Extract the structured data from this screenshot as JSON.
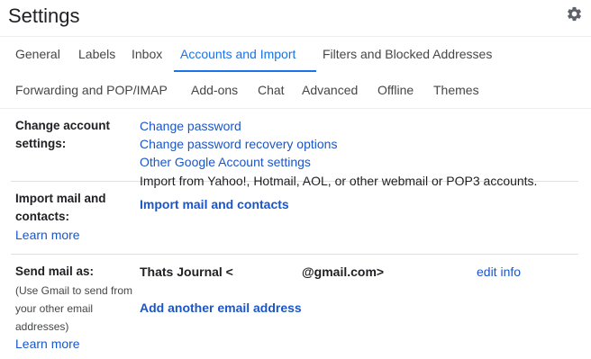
{
  "header": {
    "title": "Settings",
    "settings_icon": "gear-icon"
  },
  "tabs": {
    "row1": [
      "General",
      "Labels",
      "Inbox",
      "Accounts and Import",
      "Filters and Blocked Addresses"
    ],
    "row2": [
      "Forwarding and POP/IMAP",
      "Add-ons",
      "Chat",
      "Advanced",
      "Offline",
      "Themes"
    ],
    "active": "Accounts and Import"
  },
  "sections": {
    "change_account": {
      "label": "Change account settings:",
      "links": [
        "Change password",
        "Change password recovery options",
        "Other Google Account settings"
      ]
    },
    "import_mail": {
      "label": "Import mail and contacts:",
      "learn_more": "Learn more",
      "description": "Import from Yahoo!, Hotmail, AOL, or other webmail or POP3 accounts.",
      "action": "Import mail and contacts"
    },
    "send_mail": {
      "label": "Send mail as:",
      "note": "(Use Gmail to send from your other email addresses)",
      "learn_more": "Learn more",
      "sender_name": "Thats Journal <",
      "sender_domain": "@gmail.com>",
      "edit": "edit info",
      "add": "Add another email address"
    }
  },
  "colors": {
    "accent": "#1a73e8",
    "link": "#1a56c8",
    "divider": "#e0e0e0"
  }
}
